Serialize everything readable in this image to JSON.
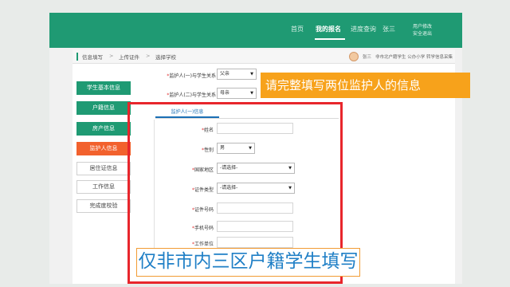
{
  "header": {
    "nav": [
      "首页",
      "我的报名",
      "进度查询",
      "张三"
    ],
    "active_index": 1,
    "right_links": [
      "用户修改",
      "安全退出"
    ]
  },
  "breadcrumb": [
    "信息填写",
    "上传证件",
    "选择学校"
  ],
  "user_line": {
    "name": "张三",
    "info": "非市北户籍学生 公办小学 转学信息采集"
  },
  "sidebar": [
    {
      "label": "学生基本信息",
      "state": "done"
    },
    {
      "label": "户籍信息",
      "state": "done"
    },
    {
      "label": "房产信息",
      "state": "done"
    },
    {
      "label": "监护人信息",
      "state": "active"
    },
    {
      "label": "居住证信息",
      "state": "todo"
    },
    {
      "label": "工作信息",
      "state": "todo"
    },
    {
      "label": "完成度校验",
      "state": "todo"
    }
  ],
  "guardian_relations": [
    {
      "label": "监护人(一)与学生关系",
      "value": "父亲"
    },
    {
      "label": "监护人(二)与学生关系",
      "value": "母亲"
    }
  ],
  "form": {
    "tab": "监护人(一)信息",
    "fields": [
      {
        "label": "姓名",
        "type": "input",
        "value": ""
      },
      {
        "label": "性别",
        "type": "select",
        "value": "男"
      },
      {
        "label": "国家地区",
        "type": "select",
        "value": "-请选择-"
      },
      {
        "label": "证件类型",
        "type": "select",
        "value": "-请选择-"
      },
      {
        "label": "证件号码",
        "type": "input",
        "value": ""
      },
      {
        "label": "手机号码",
        "type": "input",
        "value": ""
      },
      {
        "label": "工作单位",
        "type": "input",
        "value": ""
      }
    ]
  },
  "callout": "请完整填写两位监护人的信息",
  "banner": "仅非市内三区户籍学生填写",
  "colors": {
    "brand_green": "#1f9a73",
    "active_orange": "#f2612d",
    "callout_orange": "#f7a21b",
    "highlight_red": "#e8262c",
    "banner_blue": "#1f7fc6"
  }
}
